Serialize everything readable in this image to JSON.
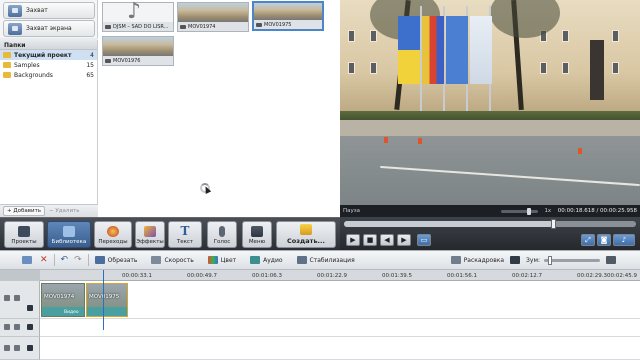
{
  "capture": {
    "capture_label": "Захват",
    "screen_capture_label": "Захват экрана"
  },
  "folders": {
    "header": "Папки",
    "items": [
      {
        "label": "Текущий проект",
        "count": "4"
      },
      {
        "label": "Samples",
        "count": "15"
      },
      {
        "label": "Backgrounds",
        "count": "65"
      }
    ],
    "add_label": "Добавить",
    "delete_label": "Удалить"
  },
  "library": {
    "items": [
      {
        "label": "DJSM – SAD DO LISR...",
        "kind": "audio"
      },
      {
        "label": "MOV01974",
        "kind": "video"
      },
      {
        "label": "MOV01975",
        "kind": "video",
        "selected": true
      },
      {
        "label": "MOV01976",
        "kind": "video"
      }
    ]
  },
  "player": {
    "status_label": "Пауза",
    "speed": "1x",
    "timecode": "00:00:18.618 / 00:00:25.958",
    "position_fraction": 0.717
  },
  "toolbar": {
    "buttons": [
      {
        "label": "Проекты",
        "icon": "film-icon"
      },
      {
        "label": "Библиотека",
        "icon": "library-icon",
        "active": true
      },
      {
        "label": "Переходы",
        "icon": "transitions-icon"
      },
      {
        "label": "Эффекты",
        "icon": "effects-icon"
      },
      {
        "label": "Текст",
        "icon": "text-icon"
      },
      {
        "label": "Голос",
        "icon": "mic-icon"
      },
      {
        "label": "Меню",
        "icon": "menu-icon"
      },
      {
        "label": "Создать...",
        "icon": "create-icon"
      }
    ]
  },
  "timeline_bar": {
    "crop": "Обрезать",
    "speed": "Скорость",
    "color": "Цвет",
    "audio": "Аудио",
    "stabilize": "Стабилизация",
    "storyboard": "Раскадровка",
    "zoom": "Зум:"
  },
  "ruler": {
    "ticks": [
      "00:00:33.1",
      "00:00:49.7",
      "00:01:06.3",
      "00:01:22.9",
      "00:01:39.5",
      "00:01:56.1",
      "00:02:12.7",
      "00:02:29.3",
      "00:02:45.9"
    ]
  },
  "tracks": {
    "clips": [
      {
        "label": "MOV01974"
      },
      {
        "label": "MOV01975"
      }
    ],
    "audio_label": "Видео"
  },
  "colors": {
    "accent": "#4a86c8",
    "toolbar_bg": "#2c3036",
    "audio_track": "#4aa0a0",
    "folder": "#e9b93c"
  }
}
